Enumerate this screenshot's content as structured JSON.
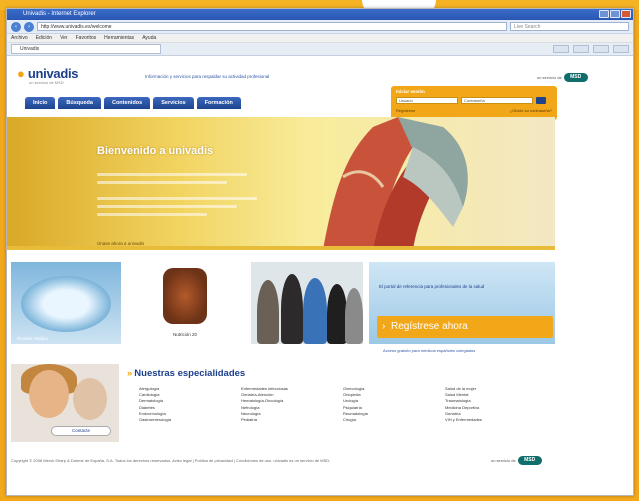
{
  "window": {
    "title": "Univadis - Internet Explorer",
    "url": "http://www.univadis.es/welcome",
    "search_placeholder": "Live Search",
    "menu": [
      "Archivo",
      "Edición",
      "Ver",
      "Favoritos",
      "Herramientas",
      "Ayuda"
    ],
    "tab_label": "Univadis"
  },
  "site": {
    "logo": "univadis",
    "logo_sub": "un servicio de MSD",
    "tagline": "Información y servicios para respaldar su actividad profesional",
    "brand_prefix": "un servicio de",
    "brand": "MSD"
  },
  "nav": [
    "Inicio",
    "Búsqueda",
    "Contenidos",
    "Servicios",
    "Formación"
  ],
  "login": {
    "title": "Iniciar sesión",
    "user_placeholder": "Usuario",
    "pass_placeholder": "Contraseña",
    "register_link": "Regístrese",
    "forgot_link": "¿Olvidó su contraseña?"
  },
  "hero": {
    "title": "Bienvenido a univadis",
    "link": "Únase ahora a univadis"
  },
  "tiles": {
    "tile1_caption": "Revista médica",
    "tile2_caption": "Nutrición 20",
    "tile4_text": "El portal de referencia para profesionales de la salud",
    "register_button": "Regístrese ahora",
    "tile4_small": "Acceso gratuito para médicos españoles colegiados",
    "tile5_button": "Contacte"
  },
  "specialties": {
    "title": "Nuestras especialidades",
    "columns": [
      [
        "Alergología",
        "Cardiología",
        "Dermatología",
        "Diabetes",
        "Endocrinología",
        "Gastroenterología"
      ],
      [
        "Enfermedades infecciosas",
        "Geriatría-Atención",
        "Hematología-Oncología",
        "Nefrología",
        "Neurología",
        "Pediatría"
      ],
      [
        "Ginecología",
        "Ortopedia",
        "Urología",
        "Psiquiatría",
        "Reumatología",
        "Cirugía"
      ],
      [
        "Salud de la mujer",
        "Salud Mental",
        "Traumatología",
        "Medicina Deportiva",
        "Geriatría",
        "VIH y Enfermedades"
      ]
    ]
  },
  "footer": "Copyright © 2008 Merck Sharp & Dohme de España, S.A. Todos los derechos reservados. Aviso legal | Política de privacidad | Condiciones de uso. univadis es un servicio de MSD."
}
